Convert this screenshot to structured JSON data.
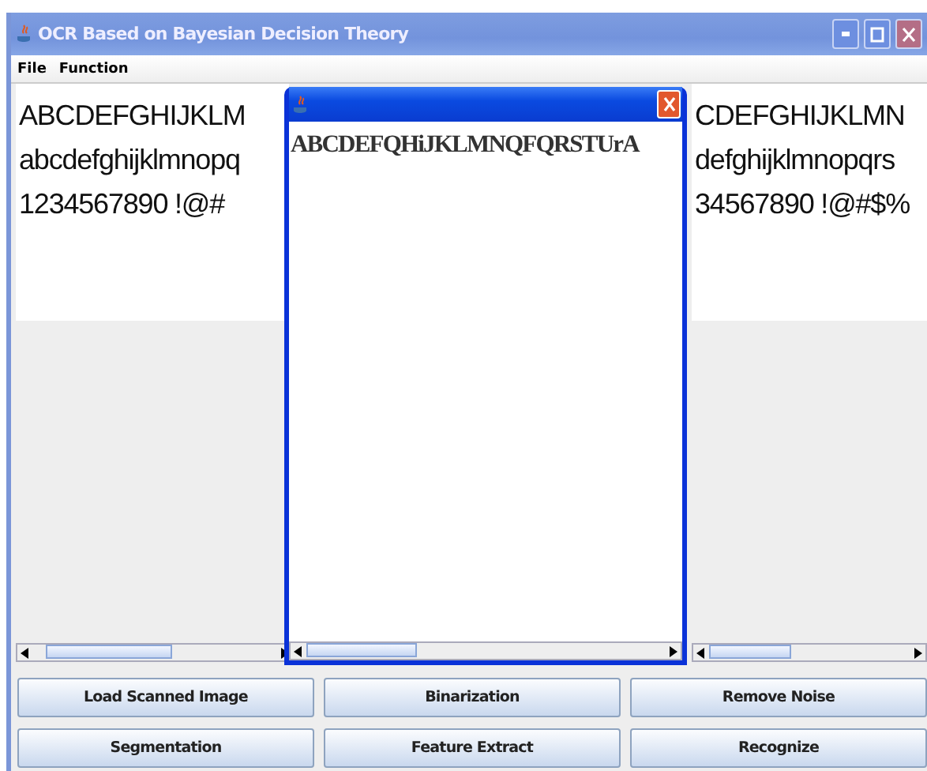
{
  "window": {
    "title": "OCR Based on Bayesian Decision Theory"
  },
  "menu": [
    "File",
    "Function"
  ],
  "left_pane": {
    "lines": [
      "ABCDEFGHIJKLM",
      "abcdefghijklmnopq",
      "1234567890 !@#"
    ]
  },
  "right_pane": {
    "lines": [
      "CDEFGHIJKLMN",
      "defghijklmnopqrs",
      "34567890 !@#$%"
    ]
  },
  "dialog": {
    "text": "ABCDEFQHiJKLMNQFQRSTUrA"
  },
  "buttons": [
    "Load Scanned Image",
    "Binarization",
    "Remove Noise",
    "Segmentation",
    "Feature Extract",
    "Recognize"
  ]
}
